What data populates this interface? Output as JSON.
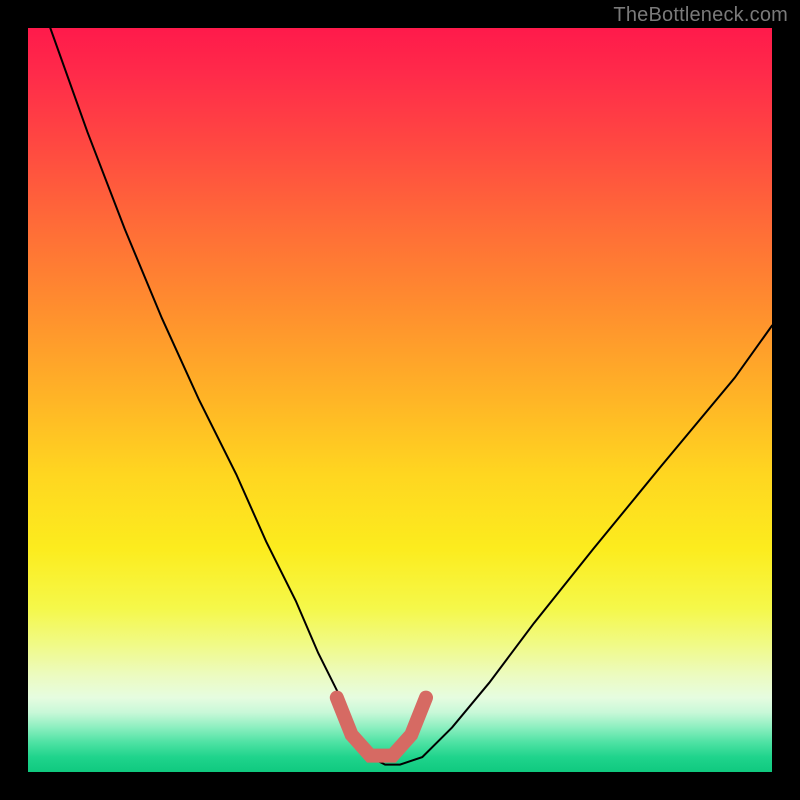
{
  "watermark": "TheBottleneck.com",
  "chart_data": {
    "type": "line",
    "title": "",
    "xlabel": "",
    "ylabel": "",
    "xlim": [
      0,
      100
    ],
    "ylim": [
      0,
      100
    ],
    "grid": false,
    "legend": false,
    "background": {
      "kind": "vertical-gradient",
      "stops": [
        {
          "pos": 0,
          "color": "#ff1a4b"
        },
        {
          "pos": 50,
          "color": "#ffb526"
        },
        {
          "pos": 78,
          "color": "#f5f84a"
        },
        {
          "pos": 100,
          "color": "#10c97f"
        }
      ],
      "meaning": "top=high bottleneck, bottom=low bottleneck"
    },
    "series": [
      {
        "name": "bottleneck-curve",
        "x": [
          3,
          8,
          13,
          18,
          23,
          28,
          32,
          36,
          39,
          42,
          44,
          46,
          48,
          50,
          53,
          57,
          62,
          68,
          76,
          85,
          95,
          100
        ],
        "y": [
          100,
          86,
          73,
          61,
          50,
          40,
          31,
          23,
          16,
          10,
          5,
          2,
          1,
          1,
          2,
          6,
          12,
          20,
          30,
          41,
          53,
          60
        ]
      }
    ],
    "annotations": [
      {
        "name": "optimal-region-marker",
        "color": "#d66a63",
        "x": [
          41.5,
          43.5,
          46,
          49,
          51.5,
          53.5
        ],
        "y": [
          10,
          5,
          2.2,
          2.2,
          5,
          10
        ]
      }
    ]
  }
}
